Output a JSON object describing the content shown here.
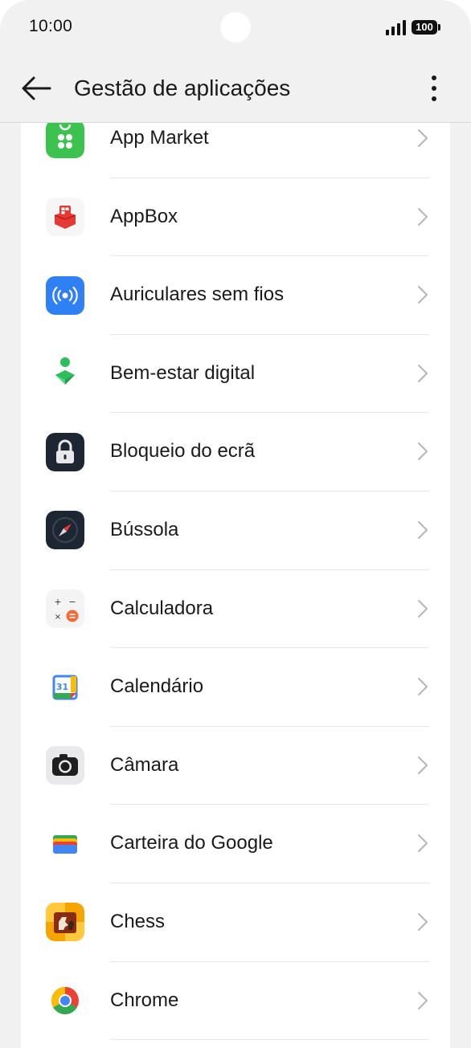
{
  "status_bar": {
    "time": "10:00",
    "battery": "100"
  },
  "header": {
    "title": "Gestão de aplicações",
    "back_icon": "arrow-left-icon",
    "more_icon": "more-vertical-icon"
  },
  "apps": [
    {
      "label": "App Market",
      "icon": "app-market-icon",
      "color": "#3cc24e"
    },
    {
      "label": "AppBox",
      "icon": "appbox-icon",
      "color": "#e53935"
    },
    {
      "label": "Auriculares sem fios",
      "icon": "wireless-earbuds-icon",
      "color": "#2f7ff5"
    },
    {
      "label": "Bem-estar digital",
      "icon": "digital-wellbeing-icon",
      "color": "#2ebd5c"
    },
    {
      "label": "Bloqueio do ecrã",
      "icon": "screen-lock-icon",
      "color": "#1f2633"
    },
    {
      "label": "Bússola",
      "icon": "compass-icon",
      "color": "#1f2633"
    },
    {
      "label": "Calculadora",
      "icon": "calculator-icon",
      "color": "#f26b3a"
    },
    {
      "label": "Calendário",
      "icon": "calendar-icon",
      "color": "#4285f4"
    },
    {
      "label": "Câmara",
      "icon": "camera-icon",
      "color": "#1f1f1f"
    },
    {
      "label": "Carteira do Google",
      "icon": "google-wallet-icon",
      "color": "#4285f4"
    },
    {
      "label": "Chess",
      "icon": "chess-icon",
      "color": "#f5a400"
    },
    {
      "label": "Chrome",
      "icon": "chrome-icon",
      "color": "#4285f4"
    }
  ]
}
